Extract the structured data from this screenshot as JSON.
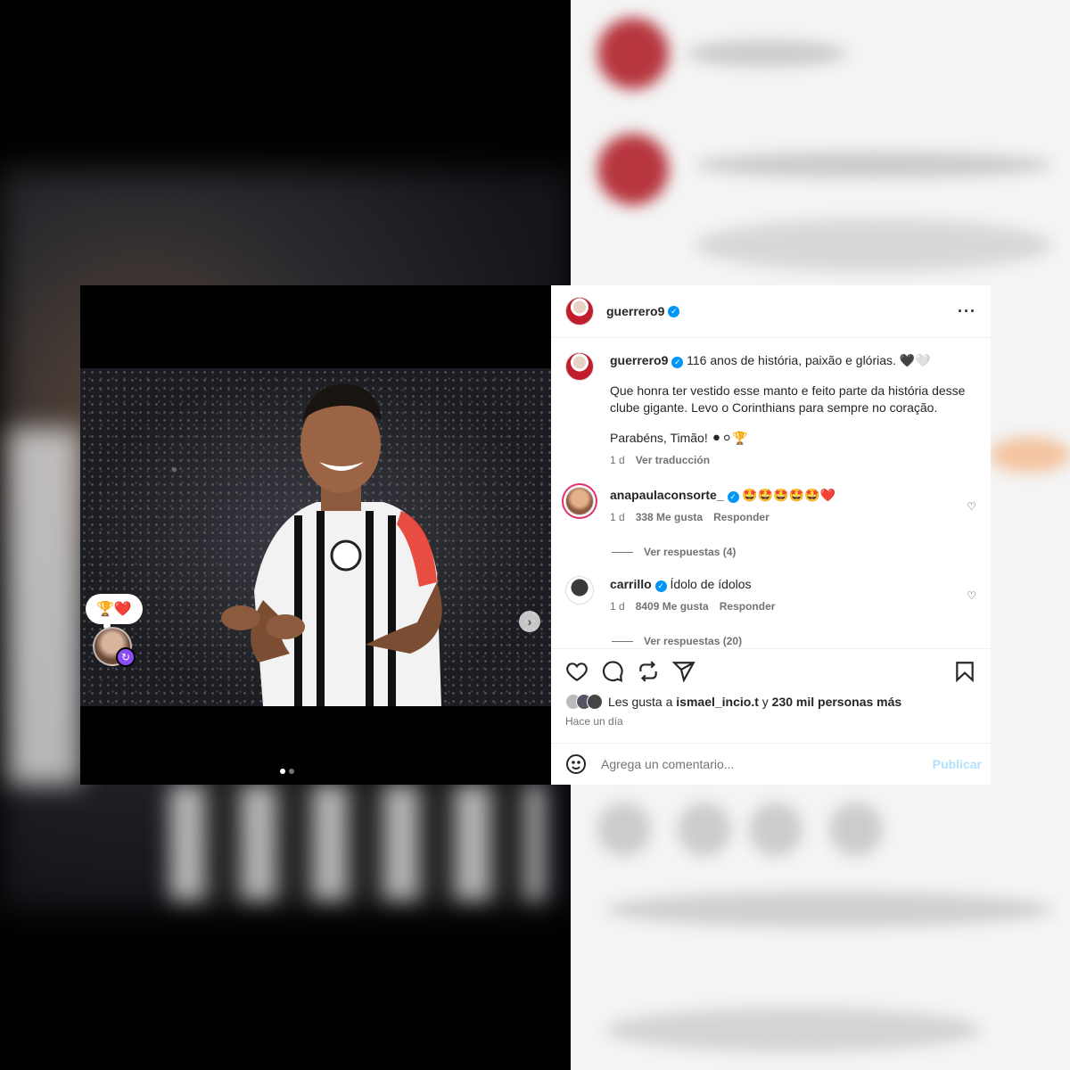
{
  "post": {
    "username": "guerrero9",
    "caption_line1": "116 anos de história, paixão e glórias. 🖤🤍",
    "caption_line2": "Que honra ter vestido esse manto e feito parte da história desse clube gigante. Levo o Corinthians para sempre no coração.",
    "caption_line3": "Parabéns, Timão! ⚫⚪🏆",
    "caption_age": "1 d",
    "translate_label": "Ver traducción"
  },
  "media": {
    "reaction": "🏆❤️",
    "next_arrow": "›",
    "slide_count": 2,
    "active_slide": 0
  },
  "comments": [
    {
      "username": "anapaulaconsorte_",
      "text": "🤩🤩🤩🤩🤩❤️",
      "age": "1 d",
      "likes": "338 Me gusta",
      "reply_label": "Responder",
      "replies_label": "Ver respuestas (4)"
    },
    {
      "username": "carrillo",
      "text": "Ídolo de ídolos",
      "age": "1 d",
      "likes": "8409 Me gusta",
      "reply_label": "Responder",
      "replies_label": "Ver respuestas (20)"
    }
  ],
  "likes": {
    "prefix": "Les gusta a",
    "first_user": "ismael_incio.t",
    "connector": "y",
    "others": "230 mil personas más"
  },
  "time_ago": "Hace un día",
  "composer": {
    "placeholder": "Agrega un comentario...",
    "post_label": "Publicar"
  },
  "icons": [
    "like-icon",
    "comment-icon",
    "repost-icon",
    "share-icon",
    "save-icon",
    "emoji-icon",
    "more-icon",
    "verified-icon"
  ],
  "colors": {
    "verified": "#0095f6",
    "link_disabled": "#b2dffc",
    "secondary_text": "#737373"
  }
}
